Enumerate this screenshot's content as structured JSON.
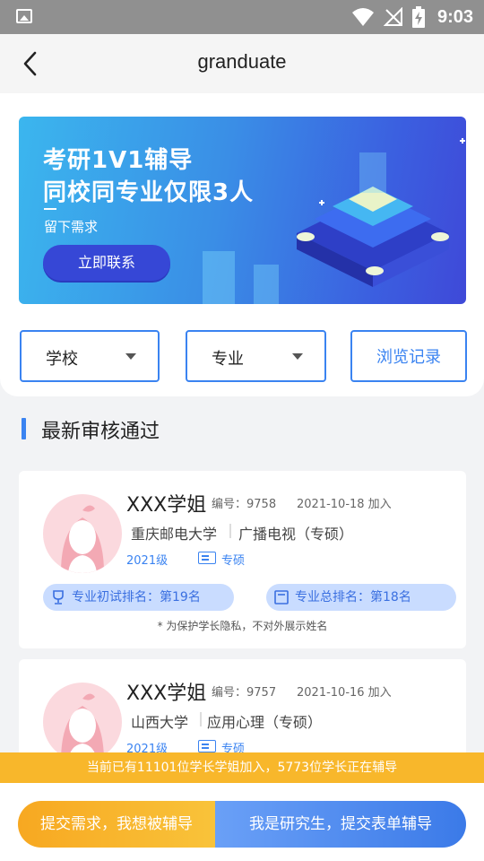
{
  "header": {
    "title": "granduate"
  },
  "status": {
    "time": "9:03"
  },
  "banner": {
    "title_line1": "考研1V1辅导",
    "title_line2": "同校同专业仅限3人",
    "subtitle": "留下需求",
    "button_label": "立即联系"
  },
  "filters": {
    "school_label": "学校",
    "major_label": "专业",
    "history_label": "浏览记录"
  },
  "section": {
    "title": "最新审核通过"
  },
  "tutors": [
    {
      "name": "XXX学姐",
      "number": "编号：9758",
      "date": "2021-10-18 加入",
      "school": "重庆邮电大学",
      "major": "广播电视（专硕）",
      "grade": "2021级",
      "degree": "专硕",
      "rank_initial": "专业初试排名：第19名",
      "rank_total": "专业总排名：第18名",
      "privacy_note": "* 为保护学长隐私，不对外展示姓名"
    },
    {
      "name": "XXX学姐",
      "number": "编号：9757",
      "date": "2021-10-16 加入",
      "school": "山西大学",
      "major": "应用心理（专硕）",
      "grade": "2021级",
      "degree": "专硕"
    }
  ],
  "notice": {
    "text": "当前已有11101位学长学姐加入，5773位学长正在辅导"
  },
  "bottom": {
    "request_label": "提交需求，我想被辅导",
    "graduate_label": "我是研究生，提交表单辅导"
  },
  "colors": {
    "accent": "#3a83f1",
    "notice_bg": "#f8b72b",
    "status_bar": "#909090"
  }
}
